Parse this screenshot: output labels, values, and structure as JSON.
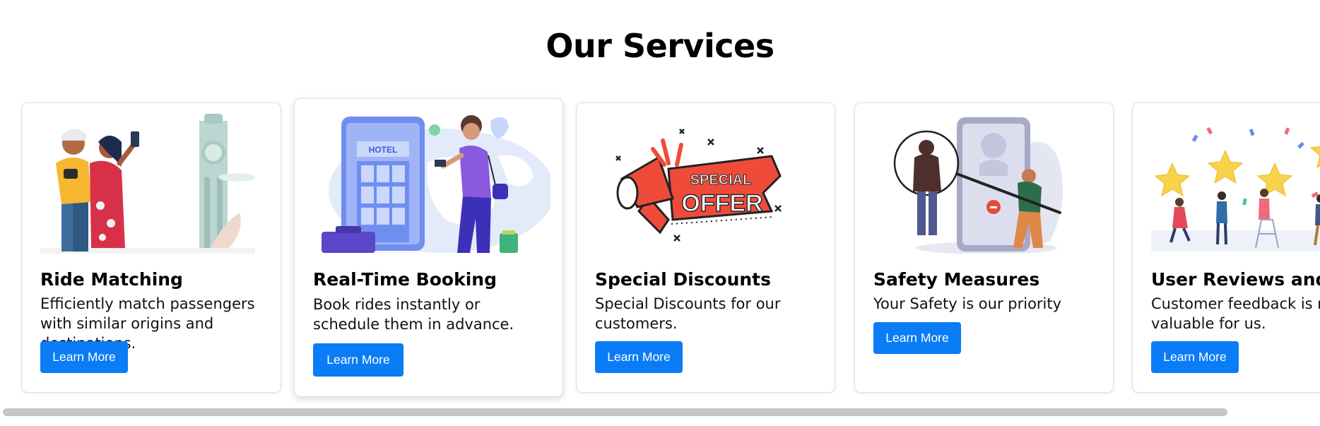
{
  "page": {
    "title": "Our Services"
  },
  "cards": [
    {
      "title": "Ride Matching",
      "description": "Efficiently match passengers with similar origins and destinations.",
      "button": "Learn More",
      "image_icon": "travel-friends-illustration"
    },
    {
      "title": "Real-Time Booking",
      "description": "Book rides instantly or schedule them in advance.",
      "button": "Learn More",
      "image_icon": "hotel-booking-illustration"
    },
    {
      "title": "Special Discounts",
      "description": "Special Discounts for our customers.",
      "button": "Learn More",
      "image_icon": "special-offer-illustration",
      "image_text": [
        "SPECIAL",
        "OFFER"
      ]
    },
    {
      "title": "Safety Measures",
      "description": "Your Safety is our priority",
      "button": "Learn More",
      "image_icon": "safety-illustration"
    },
    {
      "title": "User Reviews and Ratings",
      "description": "Customer feedback is most valuable for us.",
      "button": "Learn More",
      "image_icon": "star-ratings-illustration"
    }
  ],
  "colors": {
    "button": "#0a7cf5",
    "button_text": "#ffffff",
    "scrollbar": "#c6c6c6"
  }
}
